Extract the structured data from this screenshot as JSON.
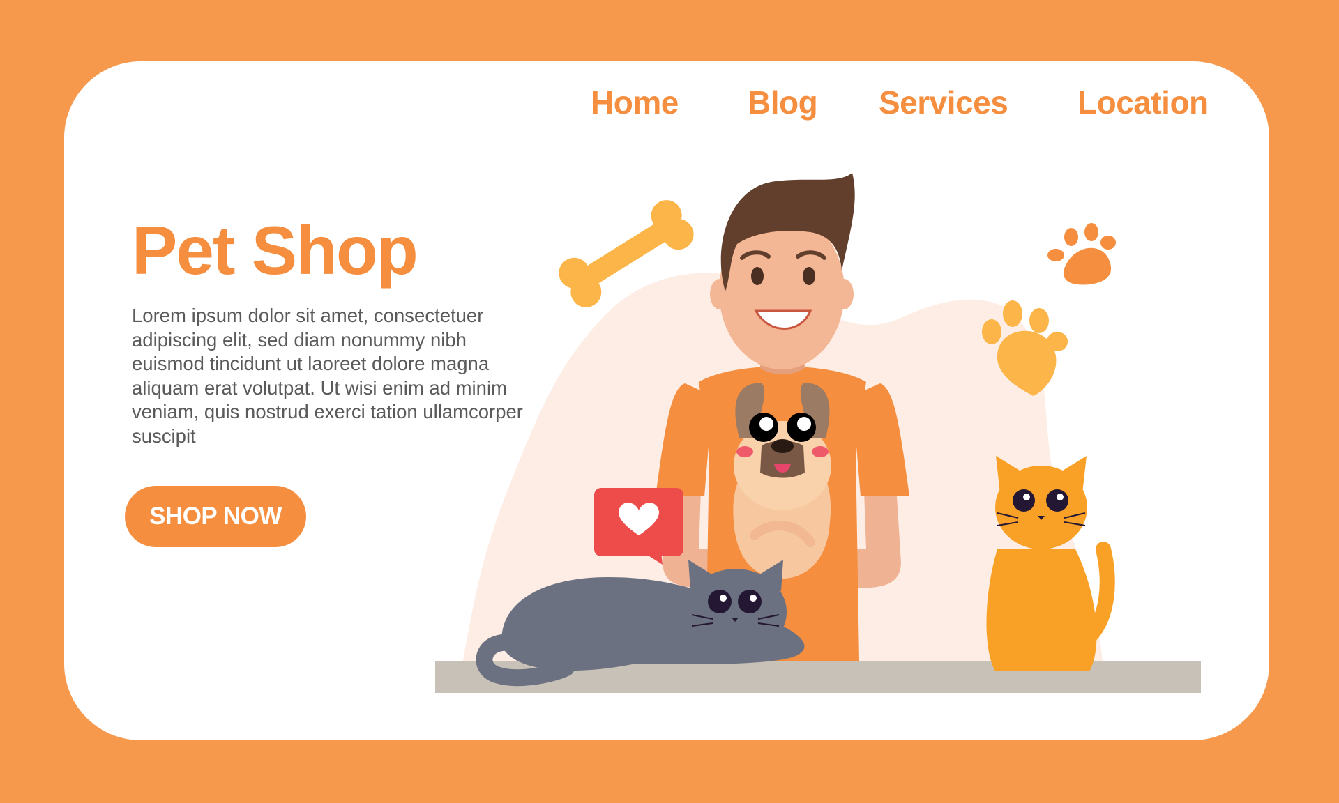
{
  "nav": {
    "home": "Home",
    "blog": "Blog",
    "services": "Services",
    "location": "Location"
  },
  "hero": {
    "title": "Pet Shop",
    "description": "Lorem ipsum dolor sit amet, consectetuer adipiscing elit, sed diam nonummy nibh euismod tincidunt ut laoreet dolore magna aliquam erat volutpat. Ut wisi enim ad minim veniam, quis nostrud exerci tation ullamcorper suscipit",
    "cta_label": "SHOP NOW"
  },
  "illustration": {
    "icons": [
      "bone-icon",
      "paw-print-icon",
      "heart-speech-bubble-icon"
    ],
    "figures": [
      "shopkeeper-man",
      "pug-dog",
      "gray-cat",
      "orange-cat"
    ]
  },
  "colors": {
    "page_background": "#F7994D",
    "accent": "#F58E3F",
    "text": "#5A5A5A",
    "card": "#FFFFFF"
  }
}
